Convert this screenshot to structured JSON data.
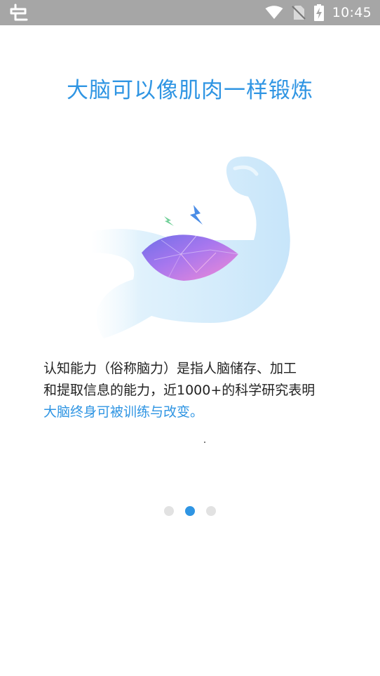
{
  "status_bar": {
    "time": "10:45",
    "app_icon": "bug-icon",
    "icons": [
      "wifi-icon",
      "no-sim-icon",
      "battery-charging-icon"
    ]
  },
  "onboarding": {
    "title": "大脑可以像肌肉一样锻炼",
    "description_line1": "认知能力（俗称脑力）是指人脑储存、加工",
    "description_line2": "和提取信息的能力，近1000+的科学研究表明",
    "description_highlight": "大脑终身可被训练与改变。",
    "illustration": "flexed-arm-brain-illustration"
  },
  "pager": {
    "total": 3,
    "active_index": 1
  },
  "colors": {
    "accent": "#2f95e3",
    "status_bar": "#a6a6a6",
    "text": "#222222",
    "dot_inactive": "#e2e2e2"
  }
}
